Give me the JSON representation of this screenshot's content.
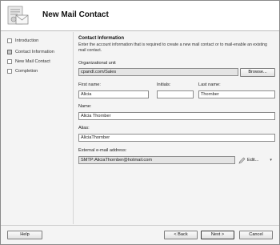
{
  "header": {
    "title": "New Mail Contact",
    "icon": "mail-contact-wizard-icon"
  },
  "nav": {
    "items": [
      {
        "label": "Introduction",
        "active": false
      },
      {
        "label": "Contact Information",
        "active": true
      },
      {
        "label": "New Mail Contact",
        "active": false
      },
      {
        "label": "Completion",
        "active": false
      }
    ]
  },
  "content": {
    "section_title": "Contact Information",
    "description": "Enter the account information that is required to create a new mail contact or to mail-enable an existing mail contact.",
    "ou": {
      "label": "Organizational unit",
      "value": "cpandl.com/Sales",
      "browse_label": "Browse..."
    },
    "first_name": {
      "label": "First name:",
      "value": "Alicia"
    },
    "initials": {
      "label": "Initials:",
      "value": ""
    },
    "last_name": {
      "label": "Last name:",
      "value": "Thornber"
    },
    "name": {
      "label": "Name:",
      "value": "Alicia Thornber"
    },
    "alias": {
      "label": "Alias:",
      "value": "AliciaThornber"
    },
    "external_email": {
      "label": "External e-mail address:",
      "value": "SMTP:AliciaThornber@hotmail.com",
      "edit_label": "Edit..."
    }
  },
  "footer": {
    "help_label": "Help",
    "back_label": "< Back",
    "next_label": "Next >",
    "cancel_label": "Cancel"
  }
}
